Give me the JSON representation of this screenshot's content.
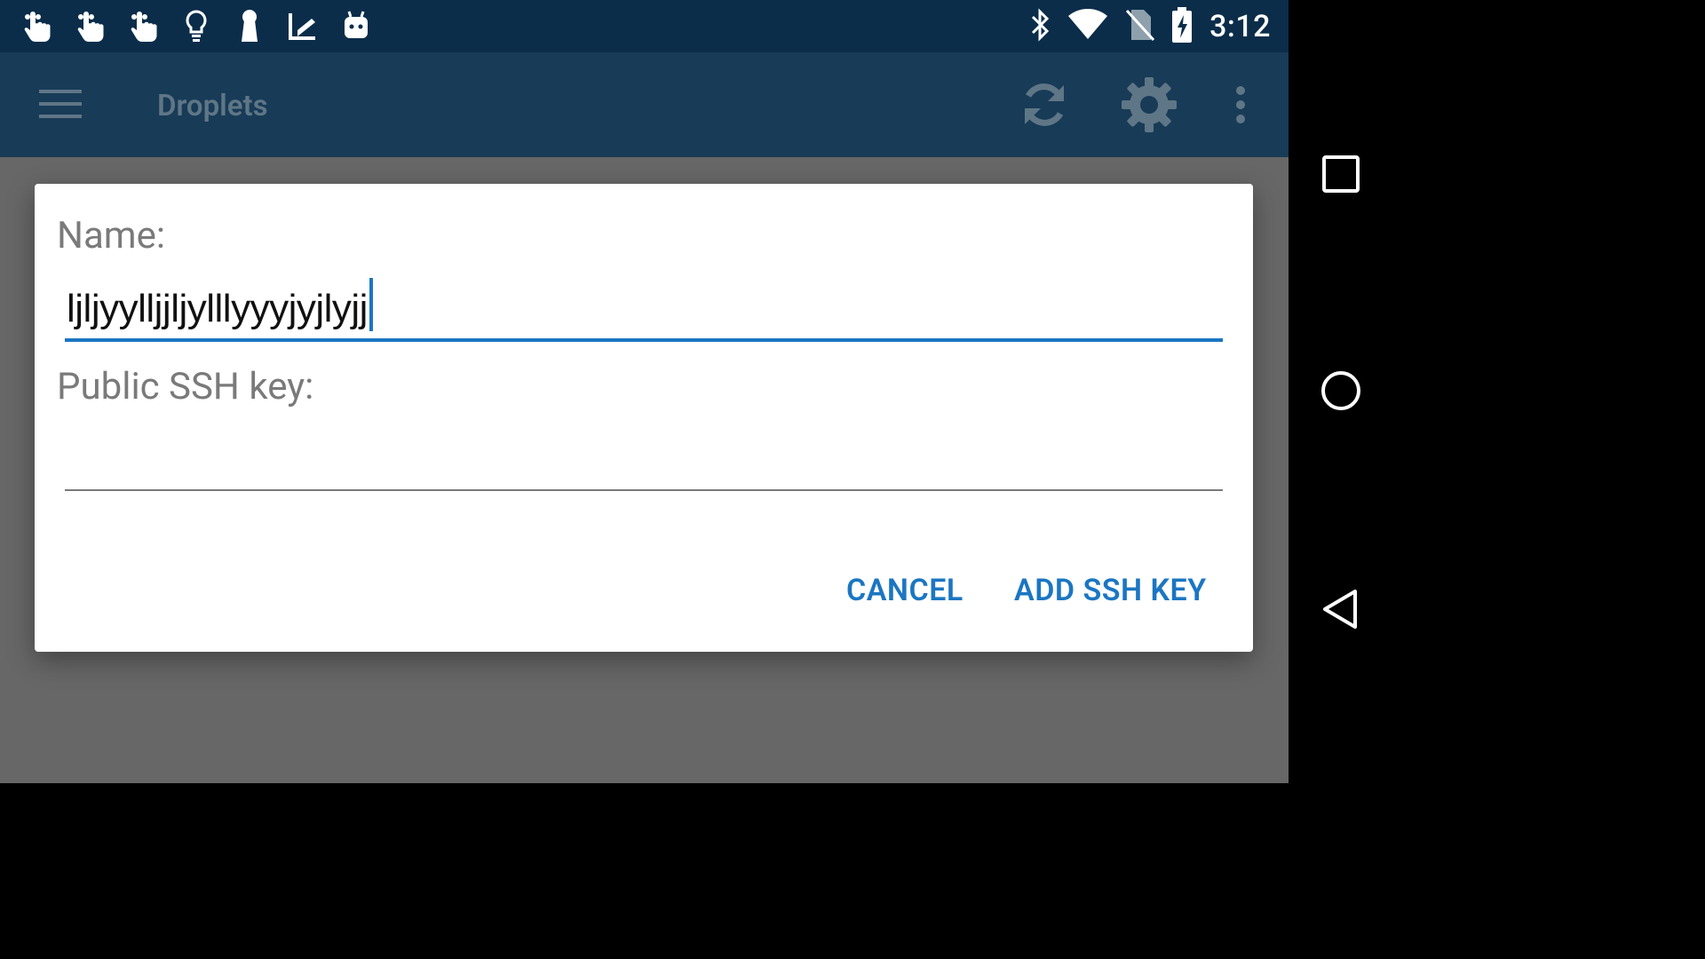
{
  "status_bar": {
    "time": "3:12",
    "left_icons": [
      "touch-icon",
      "touch-icon",
      "touch-icon",
      "lightbulb-icon",
      "keyhole-icon",
      "inbox-check-icon",
      "android-icon"
    ],
    "right_icons": [
      "bluetooth-icon",
      "wifi-icon",
      "no-sim-icon",
      "battery-charging-icon"
    ]
  },
  "app_bar": {
    "title": "Droplets",
    "actions": [
      "refresh-icon",
      "settings-icon",
      "overflow-menu-icon"
    ],
    "color": "#183b57"
  },
  "dialog": {
    "name_label": "Name:",
    "name_value": "ljljyylljjljylllyyyjyjlyjj",
    "ssh_label": "Public SSH key:",
    "ssh_value": "",
    "cancel_label": "CANCEL",
    "add_label": "ADD SSH KEY",
    "accent_color": "#1b76c2"
  },
  "nav_bar": {
    "buttons": [
      "recents-icon",
      "home-icon",
      "back-icon"
    ]
  }
}
